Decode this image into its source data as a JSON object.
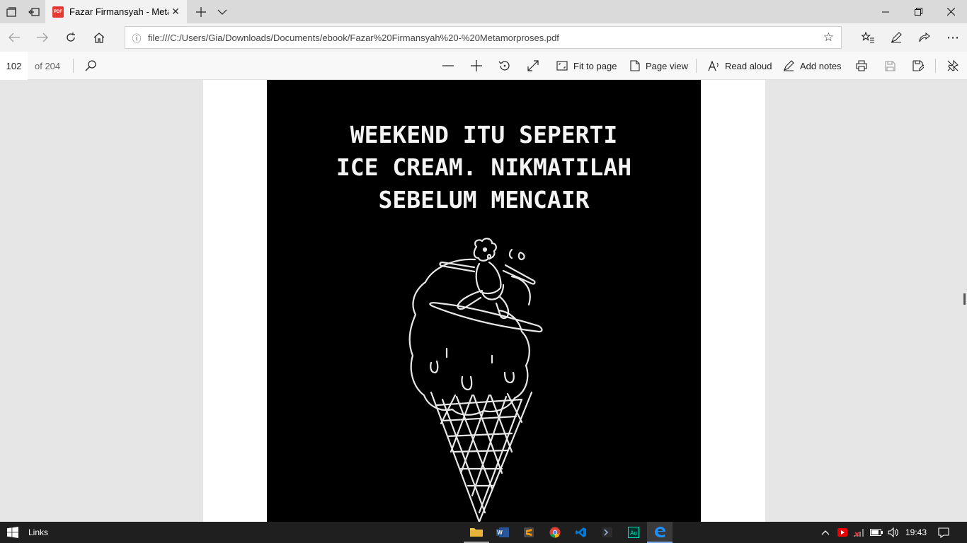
{
  "browser": {
    "tab_title": "Fazar Firmansyah - Metamorproses",
    "tab_icon_label": "PDF",
    "url": "file:///C:/Users/Gia/Downloads/Documents/ebook/Fazar%20Firmansyah%20-%20Metamorproses.pdf"
  },
  "pdf_toolbar": {
    "page_current": "102",
    "page_total": "of 204",
    "fit_to_page": "Fit to page",
    "page_view": "Page view",
    "read_aloud": "Read aloud",
    "add_notes": "Add notes"
  },
  "document": {
    "quote_lines": [
      "WEEKEND ITU SEPERTI",
      "ICE CREAM. NIKMATILAH",
      "SEBELUM MENCAIR"
    ]
  },
  "taskbar": {
    "links_label": "Links",
    "time": "19:43",
    "apps": [
      "file-explorer-icon",
      "word-icon",
      "sublime-icon",
      "chrome-icon",
      "vscode-icon",
      "terminal-icon",
      "audition-icon",
      "edge-icon"
    ]
  },
  "colors": {
    "edge_blue": "#0078d7",
    "pdf_red": "#e53935",
    "poster_bg": "#000000",
    "taskbar_bg": "#1f1f1f"
  }
}
